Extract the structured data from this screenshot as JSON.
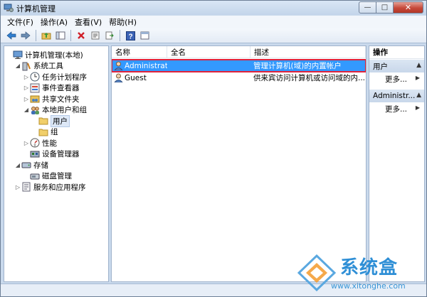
{
  "window": {
    "title": "计算机管理",
    "minimize": "—",
    "maximize": "□",
    "close": "✕"
  },
  "menu": [
    "文件(F)",
    "操作(A)",
    "查看(V)",
    "帮助(H)"
  ],
  "toolbar": [
    "back",
    "forward",
    "up",
    "show-tree",
    "delete",
    "properties",
    "export",
    "help",
    "view"
  ],
  "tree": [
    {
      "label": "计算机管理(本地)",
      "indent": 0,
      "exp": "",
      "icon": "computer-icon"
    },
    {
      "label": "系统工具",
      "indent": 1,
      "exp": "◢",
      "icon": "tools-icon"
    },
    {
      "label": "任务计划程序",
      "indent": 2,
      "exp": "▷",
      "icon": "clock-icon"
    },
    {
      "label": "事件查看器",
      "indent": 2,
      "exp": "▷",
      "icon": "event-viewer-icon"
    },
    {
      "label": "共享文件夹",
      "indent": 2,
      "exp": "▷",
      "icon": "shared-folder-icon"
    },
    {
      "label": "本地用户和组",
      "indent": 2,
      "exp": "◢",
      "icon": "users-icon"
    },
    {
      "label": "用户",
      "indent": 3,
      "exp": "",
      "icon": "folder-icon",
      "selected": true
    },
    {
      "label": "组",
      "indent": 3,
      "exp": "",
      "icon": "folder-icon"
    },
    {
      "label": "性能",
      "indent": 2,
      "exp": "▷",
      "icon": "performance-icon"
    },
    {
      "label": "设备管理器",
      "indent": 2,
      "exp": "",
      "icon": "device-manager-icon"
    },
    {
      "label": "存储",
      "indent": 1,
      "exp": "◢",
      "icon": "storage-icon"
    },
    {
      "label": "磁盘管理",
      "indent": 2,
      "exp": "",
      "icon": "disk-icon"
    },
    {
      "label": "服务和应用程序",
      "indent": 1,
      "exp": "▷",
      "icon": "services-icon"
    }
  ],
  "list": {
    "columns": [
      "名称",
      "全名",
      "描述"
    ],
    "rows": [
      {
        "name": "Administrat...",
        "fullname": "",
        "desc": "管理计算机(域)的内置帐户",
        "selected": true
      },
      {
        "name": "Guest",
        "fullname": "",
        "desc": "供来宾访问计算机或访问域的内..."
      }
    ]
  },
  "actions": {
    "title": "操作",
    "sections": [
      {
        "label": "用户",
        "item": "更多..."
      },
      {
        "label": "Administr...",
        "item": "更多..."
      }
    ]
  },
  "watermark": {
    "name": "系统盒",
    "url": "www.xitonghe.com"
  }
}
